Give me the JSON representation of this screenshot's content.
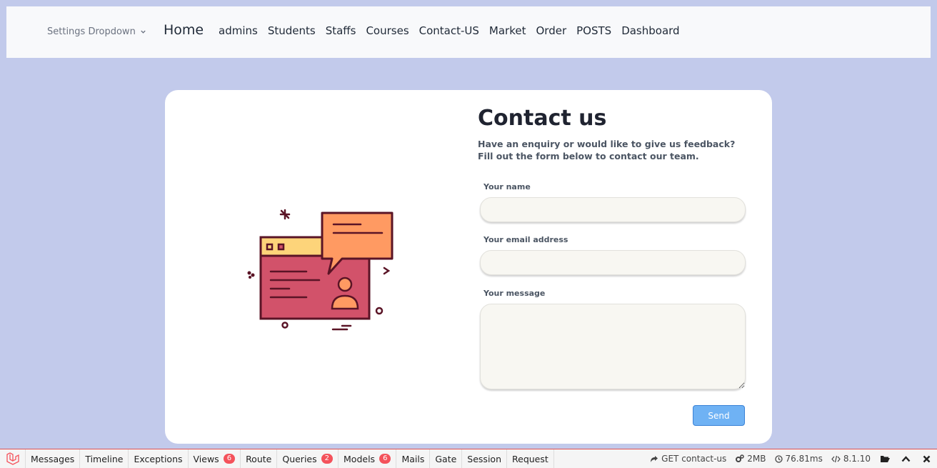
{
  "nav": {
    "settings_label": "Settings Dropdown",
    "home_label": "Home",
    "links": [
      "admins",
      "Students",
      "Staffs",
      "Courses",
      "Contact-US",
      "Market",
      "Order",
      "POSTS",
      "Dashboard"
    ]
  },
  "contact": {
    "title": "Contact us",
    "intro_line1": "Have an enquiry or would like to give us feedback?",
    "intro_line2": "Fill out the form below to contact our team.",
    "name_label": "Your name",
    "email_label": "Your email address",
    "message_label": "Your message",
    "name_value": "",
    "email_value": "",
    "message_value": "",
    "send_label": "Send"
  },
  "debugbar": {
    "tabs": [
      {
        "label": "Messages"
      },
      {
        "label": "Timeline"
      },
      {
        "label": "Exceptions"
      },
      {
        "label": "Views",
        "badge": "6"
      },
      {
        "label": "Route"
      },
      {
        "label": "Queries",
        "badge": "2"
      },
      {
        "label": "Models",
        "badge": "6"
      },
      {
        "label": "Mails"
      },
      {
        "label": "Gate"
      },
      {
        "label": "Session"
      },
      {
        "label": "Request"
      }
    ],
    "route": "GET contact-us",
    "memory": "2MB",
    "time": "76.81ms",
    "version": "8.1.10",
    "accent": "#f4525b"
  },
  "colors": {
    "page_bg": "#c2caeb",
    "button": "#6fb2f4"
  }
}
